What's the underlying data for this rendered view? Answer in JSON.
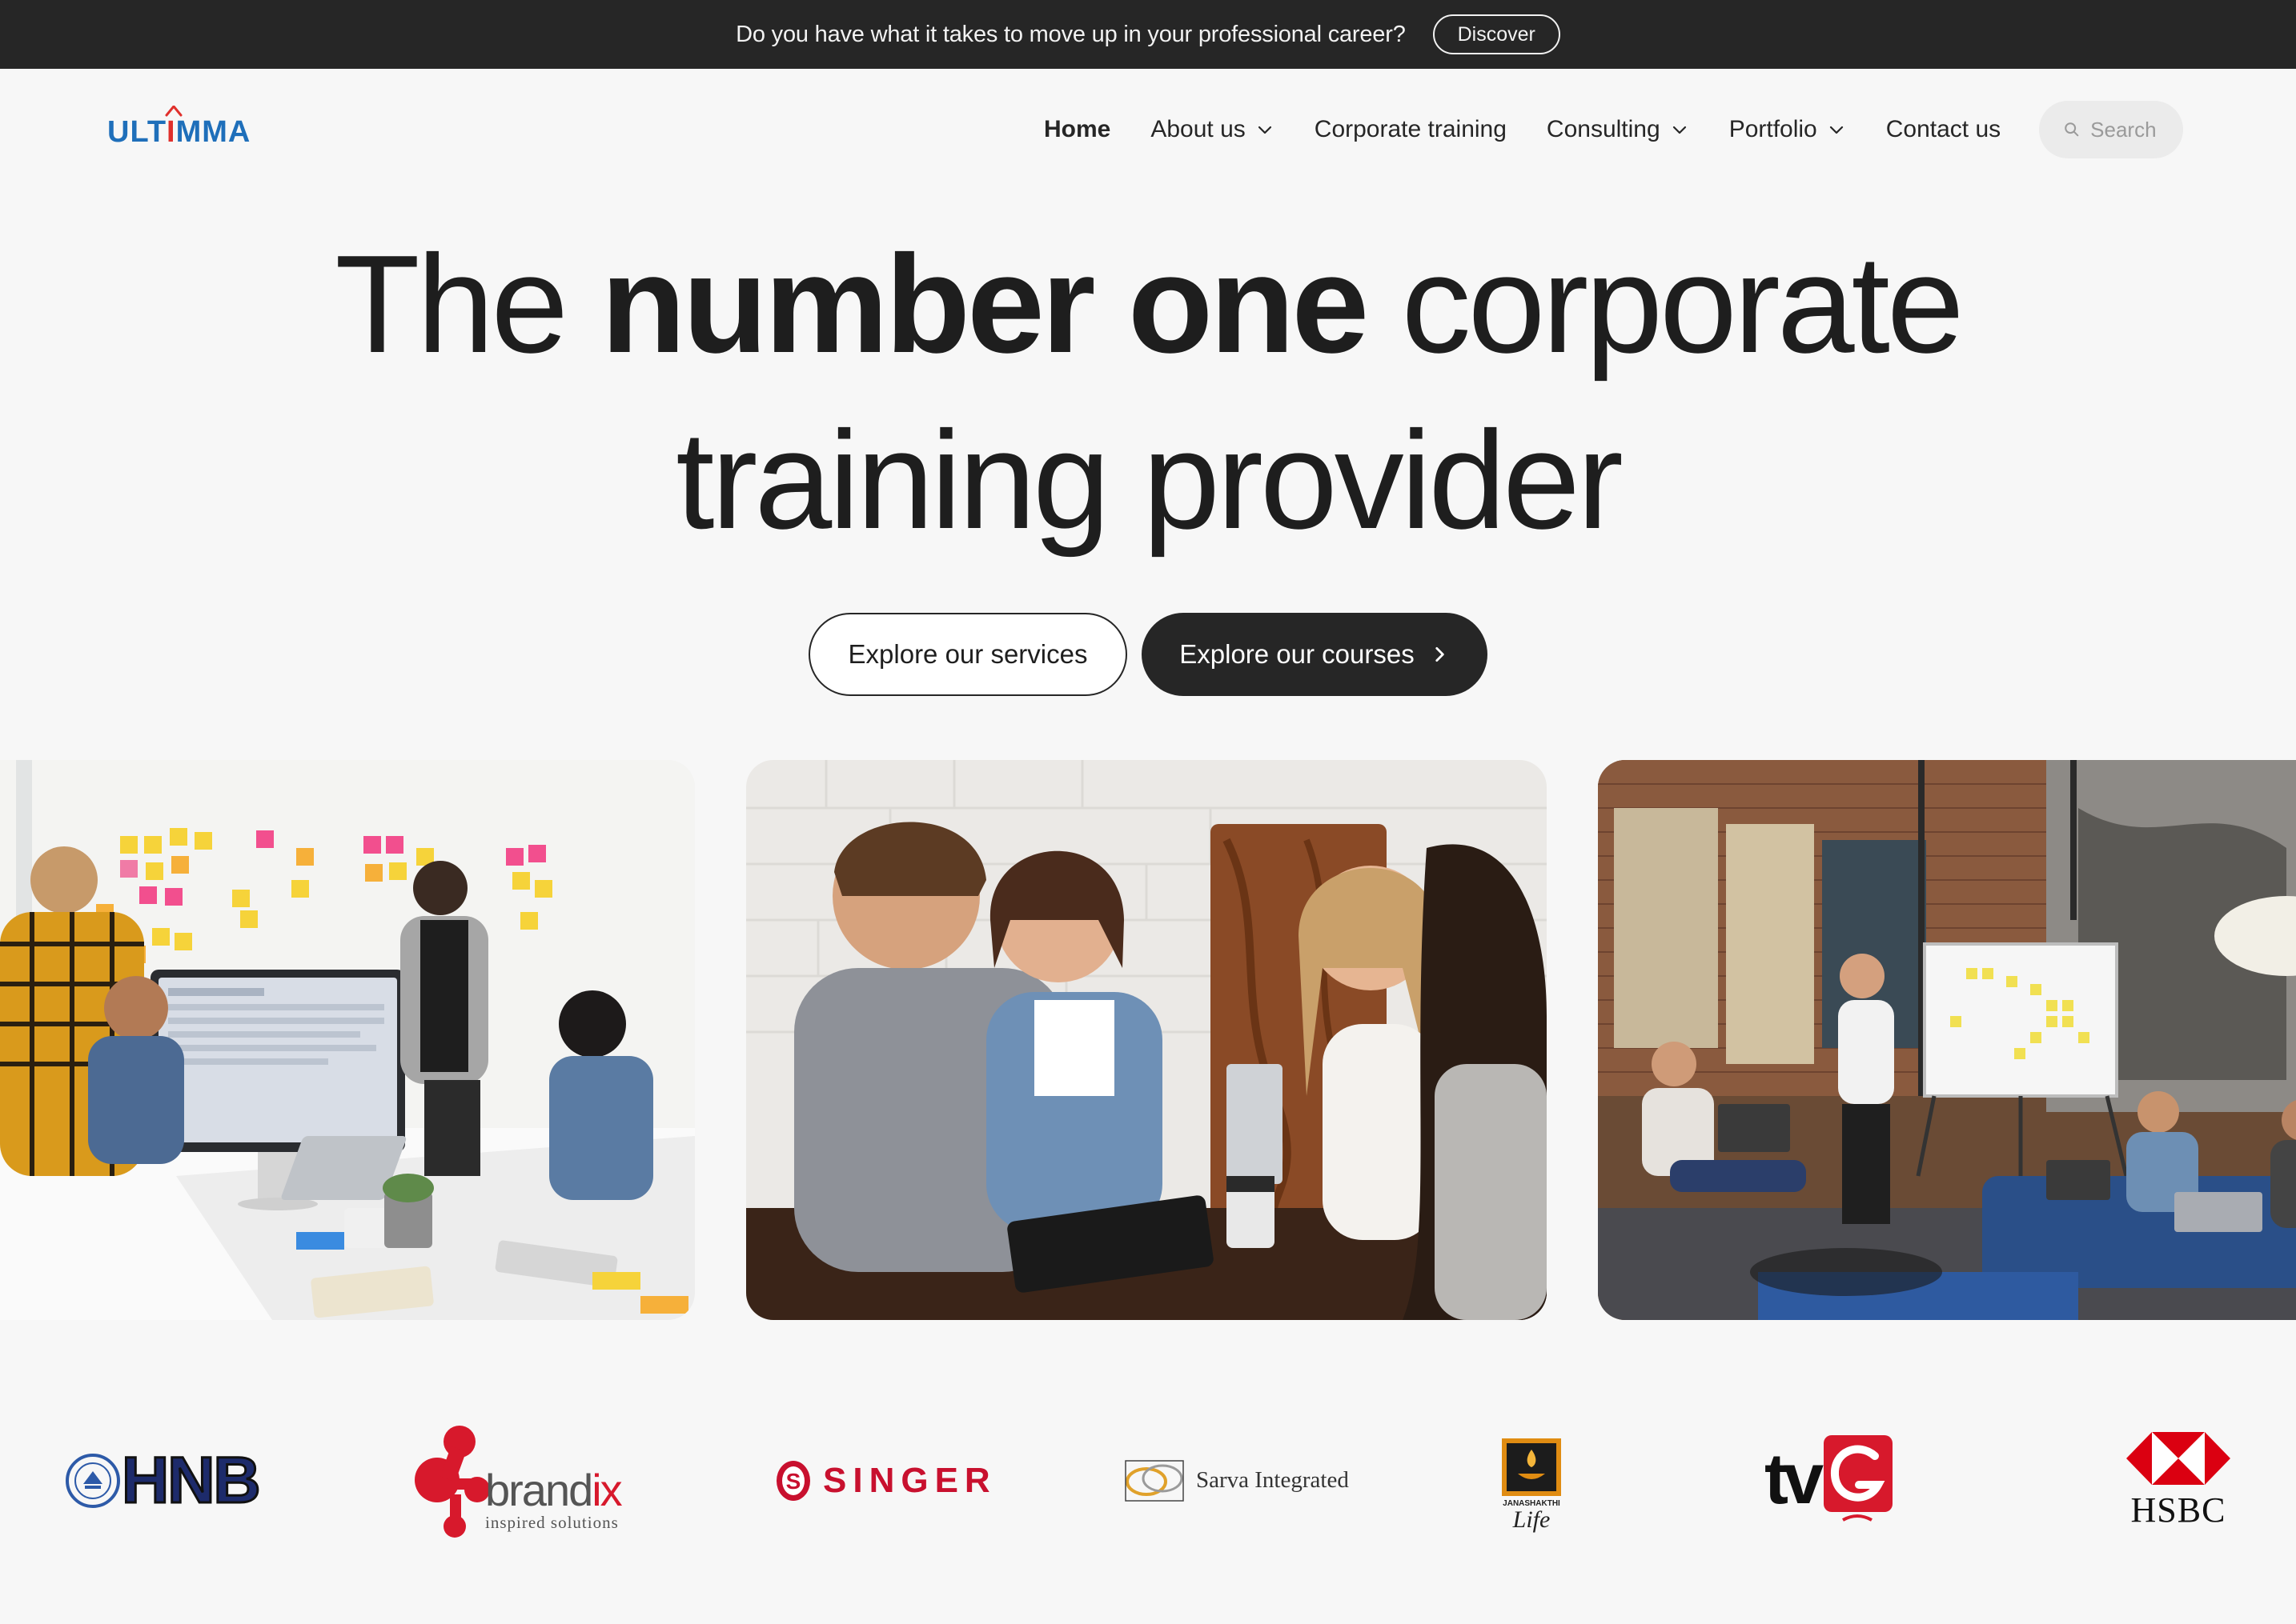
{
  "announcement": {
    "text": "Do you have what it takes to move up in your professional career?",
    "button_label": "Discover"
  },
  "brand": {
    "logo_text_pre": "ULT",
    "logo_text_accent": "I",
    "logo_text_post": "MMA",
    "colors": {
      "primary": "#1f6fba",
      "accent": "#e0302c"
    }
  },
  "nav": {
    "items": [
      {
        "label": "Home",
        "active": true,
        "has_dropdown": false
      },
      {
        "label": "About us",
        "active": false,
        "has_dropdown": true
      },
      {
        "label": "Corporate training",
        "active": false,
        "has_dropdown": false
      },
      {
        "label": "Consulting",
        "active": false,
        "has_dropdown": true
      },
      {
        "label": "Portfolio",
        "active": false,
        "has_dropdown": true
      },
      {
        "label": "Contact us",
        "active": false,
        "has_dropdown": false
      }
    ],
    "search_placeholder": "Search"
  },
  "hero": {
    "title_part1": "The ",
    "title_bold": "number one",
    "title_part2": " corporate",
    "title_line2": "training provider",
    "primary_cta": "Explore our services",
    "secondary_cta": "Explore our courses"
  },
  "photos": [
    {
      "icon": "team-whiteboard-photo"
    },
    {
      "icon": "friends-laughing-photo"
    },
    {
      "icon": "office-presentation-photo"
    }
  ],
  "clients": {
    "hnb": "HNB",
    "brandix_pre": "brand",
    "brandix_ix": "ix",
    "brandix_tagline": "inspired solutions",
    "singer": "SINGER",
    "sarva": "Sarva Integrated",
    "janashakthi_small": "JANASHAKTHI",
    "janashakthi_life": "Life",
    "tv": "tv",
    "hsbc": "HSBC"
  },
  "colors": {
    "dark": "#262626",
    "background": "#f7f7f7"
  }
}
